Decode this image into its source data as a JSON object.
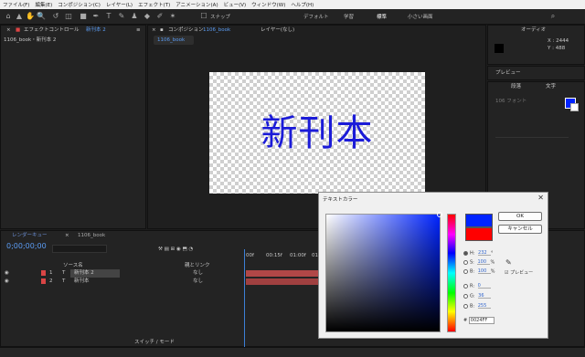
{
  "menu": [
    "ファイル(F)",
    "編集(E)",
    "コンポジション(C)",
    "レイヤー(L)",
    "エフェクト(T)",
    "アニメーション(A)",
    "ビュー(V)",
    "ウィンドウ(W)",
    "ヘルプ(H)"
  ],
  "workspaces": [
    "デフォルト",
    "学習",
    "標準",
    "小さい画面"
  ],
  "workspace_active": "標準",
  "toolbar": {
    "snap_label": "スナップ"
  },
  "effects_panel": {
    "tab": "エフェクトコントロール",
    "tab_target": "新刊本 2",
    "crumb": "1106_book・新刊本 2"
  },
  "comp_panel": {
    "tab": "コンポジション",
    "tab_target": "1106_book",
    "layer_tab": "レイヤー(なし)",
    "comp_tab": "1106_book"
  },
  "comp_text": "新刊本",
  "info_panel": {
    "label": "オーディオ",
    "x": "X : 2444",
    "y": "Y : 488"
  },
  "preview_panel": "プレビュー",
  "character_panel": {
    "tab1": "段落",
    "tab2": "文字",
    "font": "106 フォント"
  },
  "timeline": {
    "tab": "1106_book",
    "render_queue": "レンダーキュー",
    "timecode": "0;00;00;00",
    "search_placeholder": "",
    "col_source": "ソース名",
    "col_parent": "親とリンク",
    "ruler": [
      "00f",
      "00:15f",
      "01:00f",
      "01:15f"
    ],
    "switch_mode": "スイッチ / モード",
    "layers": [
      {
        "num": "1",
        "type": "T",
        "name": "新刊本 2",
        "parent": "なし",
        "color": "#d94545"
      },
      {
        "num": "2",
        "type": "T",
        "name": "新刊本",
        "parent": "なし",
        "color": "#d94545"
      }
    ]
  },
  "dialog": {
    "title": "テキストカラー",
    "ok": "OK",
    "cancel": "キャンセル",
    "new_color": "#0024ff",
    "old_color": "#ff0000",
    "H": "232",
    "S": "100",
    "B": "100",
    "R": "0",
    "G": "36",
    "Bv": "255",
    "hex": "0024FF",
    "preview_label": "プレビュー",
    "unit_deg": "°",
    "unit_pct": "%"
  }
}
